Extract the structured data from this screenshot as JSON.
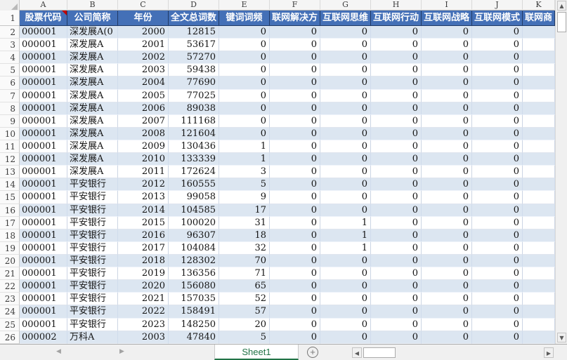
{
  "columns": {
    "letters": [
      "A",
      "B",
      "C",
      "D",
      "E",
      "F",
      "G",
      "H",
      "I",
      "J",
      "K"
    ]
  },
  "header_row": {
    "number": "1",
    "cells": [
      "股票代码",
      "公司简称",
      "年份",
      "全文总词数",
      "键词词频",
      "联网解决方",
      "互联网思维",
      "互联网行动",
      "互联网战略",
      "互联网模式",
      "联网商"
    ],
    "comment_marker_col": "A"
  },
  "rows": [
    [
      "2",
      "000001",
      "深发展A(0",
      "2000",
      "12815",
      "0",
      "0",
      "0",
      "0",
      "0",
      "0",
      ""
    ],
    [
      "3",
      "000001",
      "深发展A",
      "2001",
      "53617",
      "0",
      "0",
      "0",
      "0",
      "0",
      "0",
      ""
    ],
    [
      "4",
      "000001",
      "深发展A",
      "2002",
      "57270",
      "0",
      "0",
      "0",
      "0",
      "0",
      "0",
      ""
    ],
    [
      "5",
      "000001",
      "深发展A",
      "2003",
      "59438",
      "0",
      "0",
      "0",
      "0",
      "0",
      "0",
      ""
    ],
    [
      "6",
      "000001",
      "深发展A",
      "2004",
      "77690",
      "0",
      "0",
      "0",
      "0",
      "0",
      "0",
      ""
    ],
    [
      "7",
      "000001",
      "深发展A",
      "2005",
      "77025",
      "0",
      "0",
      "0",
      "0",
      "0",
      "0",
      ""
    ],
    [
      "8",
      "000001",
      "深发展A",
      "2006",
      "89038",
      "0",
      "0",
      "0",
      "0",
      "0",
      "0",
      ""
    ],
    [
      "9",
      "000001",
      "深发展A",
      "2007",
      "111168",
      "0",
      "0",
      "0",
      "0",
      "0",
      "0",
      ""
    ],
    [
      "10",
      "000001",
      "深发展A",
      "2008",
      "121604",
      "0",
      "0",
      "0",
      "0",
      "0",
      "0",
      ""
    ],
    [
      "11",
      "000001",
      "深发展A",
      "2009",
      "130436",
      "1",
      "0",
      "0",
      "0",
      "0",
      "0",
      ""
    ],
    [
      "12",
      "000001",
      "深发展A",
      "2010",
      "133339",
      "1",
      "0",
      "0",
      "0",
      "0",
      "0",
      ""
    ],
    [
      "13",
      "000001",
      "深发展A",
      "2011",
      "172624",
      "3",
      "0",
      "0",
      "0",
      "0",
      "0",
      ""
    ],
    [
      "14",
      "000001",
      "平安银行",
      "2012",
      "160555",
      "5",
      "0",
      "0",
      "0",
      "0",
      "0",
      ""
    ],
    [
      "15",
      "000001",
      "平安银行",
      "2013",
      "99058",
      "9",
      "0",
      "0",
      "0",
      "0",
      "0",
      ""
    ],
    [
      "16",
      "000001",
      "平安银行",
      "2014",
      "104585",
      "17",
      "0",
      "0",
      "0",
      "0",
      "0",
      ""
    ],
    [
      "17",
      "000001",
      "平安银行",
      "2015",
      "100020",
      "31",
      "0",
      "1",
      "0",
      "0",
      "0",
      ""
    ],
    [
      "18",
      "000001",
      "平安银行",
      "2016",
      "96307",
      "18",
      "0",
      "1",
      "0",
      "0",
      "0",
      ""
    ],
    [
      "19",
      "000001",
      "平安银行",
      "2017",
      "104084",
      "32",
      "0",
      "1",
      "0",
      "0",
      "0",
      ""
    ],
    [
      "20",
      "000001",
      "平安银行",
      "2018",
      "128302",
      "70",
      "0",
      "0",
      "0",
      "0",
      "0",
      ""
    ],
    [
      "21",
      "000001",
      "平安银行",
      "2019",
      "136356",
      "71",
      "0",
      "0",
      "0",
      "0",
      "0",
      ""
    ],
    [
      "22",
      "000001",
      "平安银行",
      "2020",
      "156080",
      "65",
      "0",
      "0",
      "0",
      "0",
      "0",
      ""
    ],
    [
      "23",
      "000001",
      "平安银行",
      "2021",
      "157035",
      "52",
      "0",
      "0",
      "0",
      "0",
      "0",
      ""
    ],
    [
      "24",
      "000001",
      "平安银行",
      "2022",
      "158491",
      "57",
      "0",
      "0",
      "0",
      "0",
      "0",
      ""
    ],
    [
      "25",
      "000001",
      "平安银行",
      "2023",
      "148250",
      "20",
      "0",
      "0",
      "0",
      "0",
      "0",
      ""
    ],
    [
      "26",
      "000002",
      "万科A",
      "2003",
      "47840",
      "5",
      "0",
      "0",
      "0",
      "0",
      "0",
      ""
    ]
  ],
  "tab_bar": {
    "prev_arrow": "◀",
    "next_arrow": "▶",
    "active_tab": "Sheet1",
    "add_sheet": "+"
  },
  "scrollbars": {
    "v_up": "▲",
    "v_down": "▼",
    "h_left": "◀",
    "h_right": "▶"
  },
  "colors": {
    "header_bg": "#4470b7",
    "band_bg": "#dce6f1",
    "tab_green": "#217346",
    "comment_red": "#c00000"
  }
}
